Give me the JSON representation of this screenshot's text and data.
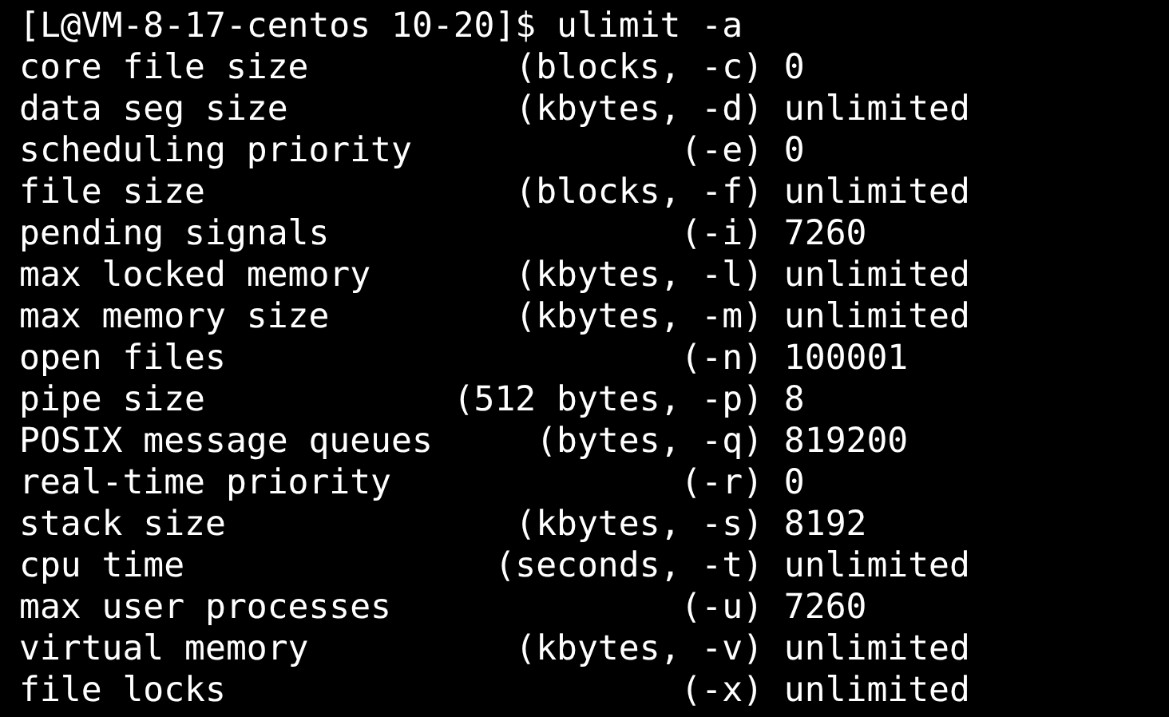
{
  "terminal": {
    "command_line": "[L@VM-8-17-centos 10-20]$ ulimit -a",
    "output_lines": [
      "core file size          (blocks, -c) 0",
      "data seg size           (kbytes, -d) unlimited",
      "scheduling priority             (-e) 0",
      "file size               (blocks, -f) unlimited",
      "pending signals                 (-i) 7260",
      "max locked memory       (kbytes, -l) unlimited",
      "max memory size         (kbytes, -m) unlimited",
      "open files                      (-n) 100001",
      "pipe size            (512 bytes, -p) 8",
      "POSIX message queues     (bytes, -q) 819200",
      "real-time priority              (-r) 0",
      "stack size              (kbytes, -s) 8192",
      "cpu time               (seconds, -t) unlimited",
      "max user processes              (-u) 7260",
      "virtual memory          (kbytes, -v) unlimited",
      "file locks                      (-x) unlimited"
    ]
  }
}
